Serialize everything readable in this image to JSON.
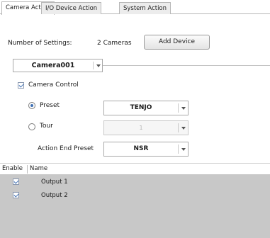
{
  "tabs": [
    {
      "label": "Camera Action",
      "active": true
    },
    {
      "label": "I/O Device Action",
      "active": false
    },
    {
      "label": "System Action",
      "active": false
    }
  ],
  "settings": {
    "number_label": "Number of Settings:",
    "number_value": "2 Cameras",
    "add_button": "Add Device"
  },
  "camera_select": {
    "value": "Camera001"
  },
  "camera_control": {
    "label": "Camera Control",
    "checked": true
  },
  "preset": {
    "label": "Preset",
    "selected": true,
    "value": "TENJO"
  },
  "tour": {
    "label": "Tour",
    "selected": false,
    "value": "1",
    "disabled": true
  },
  "action_end_preset": {
    "label": "Action End Preset",
    "value": "NSR"
  },
  "table": {
    "columns": [
      "Enable",
      "Name"
    ],
    "rows": [
      {
        "enabled": true,
        "name": "Output 1"
      },
      {
        "enabled": true,
        "name": "Output 2"
      }
    ]
  },
  "colors": {
    "list_background": "#c8c8c8",
    "check_accent": "#3e6fb3"
  }
}
